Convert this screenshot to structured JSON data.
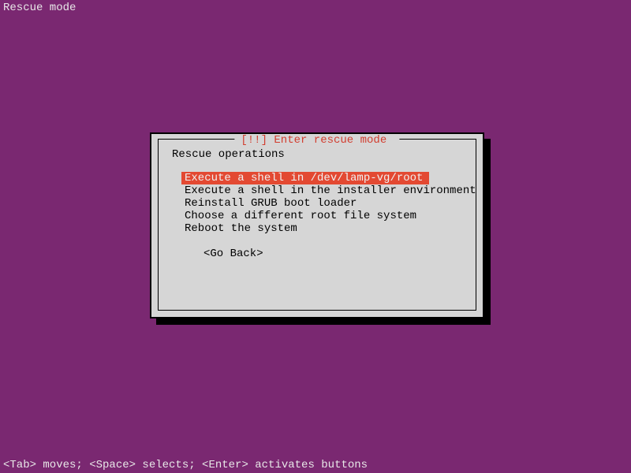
{
  "header": {
    "title": "Rescue mode"
  },
  "dialog": {
    "title_prefix": "[!!] ",
    "title": "Enter rescue mode",
    "prompt": "Rescue operations",
    "menu_items": [
      "Execute a shell in /dev/lamp-vg/root",
      "Execute a shell in the installer environment",
      "Reinstall GRUB boot loader",
      "Choose a different root file system",
      "Reboot the system"
    ],
    "selected_index": 0,
    "go_back": "<Go Back>"
  },
  "footer": {
    "hint": "<Tab> moves; <Space> selects; <Enter> activates buttons"
  }
}
